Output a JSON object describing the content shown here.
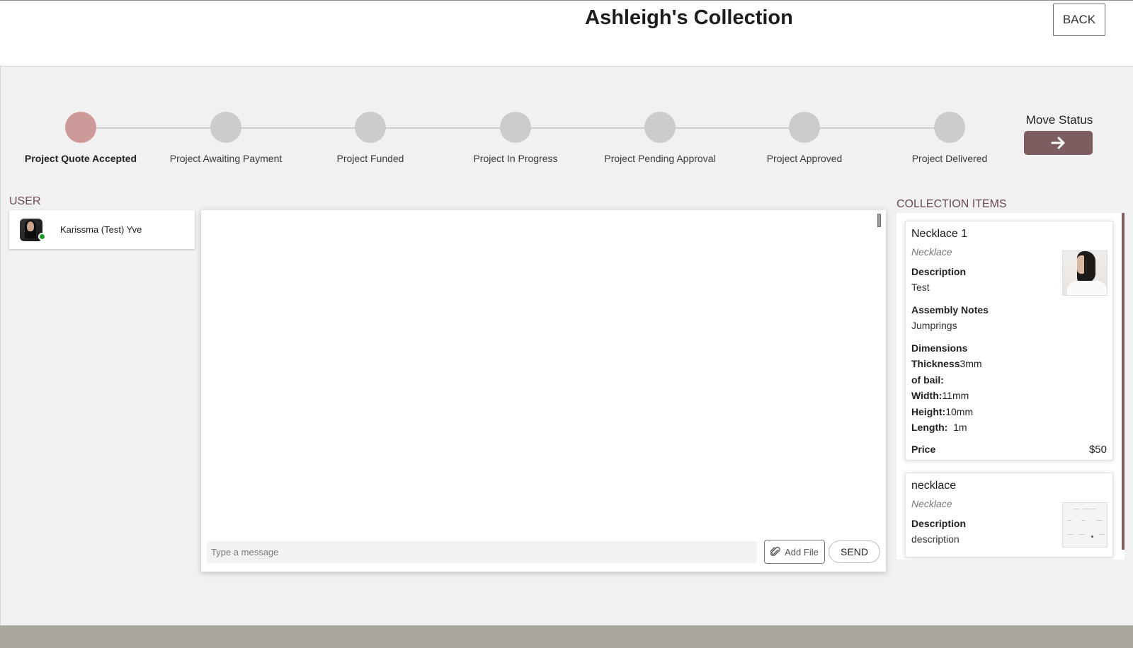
{
  "header": {
    "title": "Ashleigh's Collection",
    "back_label": "BACK"
  },
  "progress": {
    "steps": [
      {
        "label": "Project Quote Accepted",
        "active": true
      },
      {
        "label": "Project Awaiting Payment",
        "active": false
      },
      {
        "label": "Project Funded",
        "active": false
      },
      {
        "label": "Project In Progress",
        "active": false
      },
      {
        "label": "Project Pending Approval",
        "active": false
      },
      {
        "label": "Project Approved",
        "active": false
      },
      {
        "label": "Project Delivered",
        "active": false
      }
    ],
    "move_status_label": "Move Status"
  },
  "users": {
    "heading": "USER",
    "items": [
      {
        "name": "Karissma (Test) Yve",
        "online": true
      }
    ]
  },
  "chat": {
    "placeholder": "Type a message",
    "message_value": "",
    "add_file_label": "Add File",
    "send_label": "SEND"
  },
  "collection": {
    "heading": "COLLECTION ITEMS",
    "items": [
      {
        "name": "Necklace 1",
        "type": "Necklace",
        "description_label": "Description",
        "description": "Test",
        "assembly_label": "Assembly Notes",
        "assembly": "Jumprings",
        "dimensions_label": "Dimensions",
        "dimensions": {
          "thickness_label_line1": "Thickness",
          "thickness_label_line2": "of bail:",
          "thickness": "3mm",
          "width_label": "Width:",
          "width": "11mm",
          "height_label": "Height:",
          "height": "10mm",
          "length_label": "Length:",
          "length": "1m"
        },
        "price_label": "Price",
        "price": "$50"
      },
      {
        "name": "necklace",
        "type": "Necklace",
        "description_label": "Description",
        "description": "description"
      }
    ]
  },
  "colors": {
    "accent": "#7e5d61",
    "active_step": "#cd9a9a",
    "inactive_step": "#cccccc",
    "online": "#1a9a2a",
    "footer": "#aba69f"
  }
}
